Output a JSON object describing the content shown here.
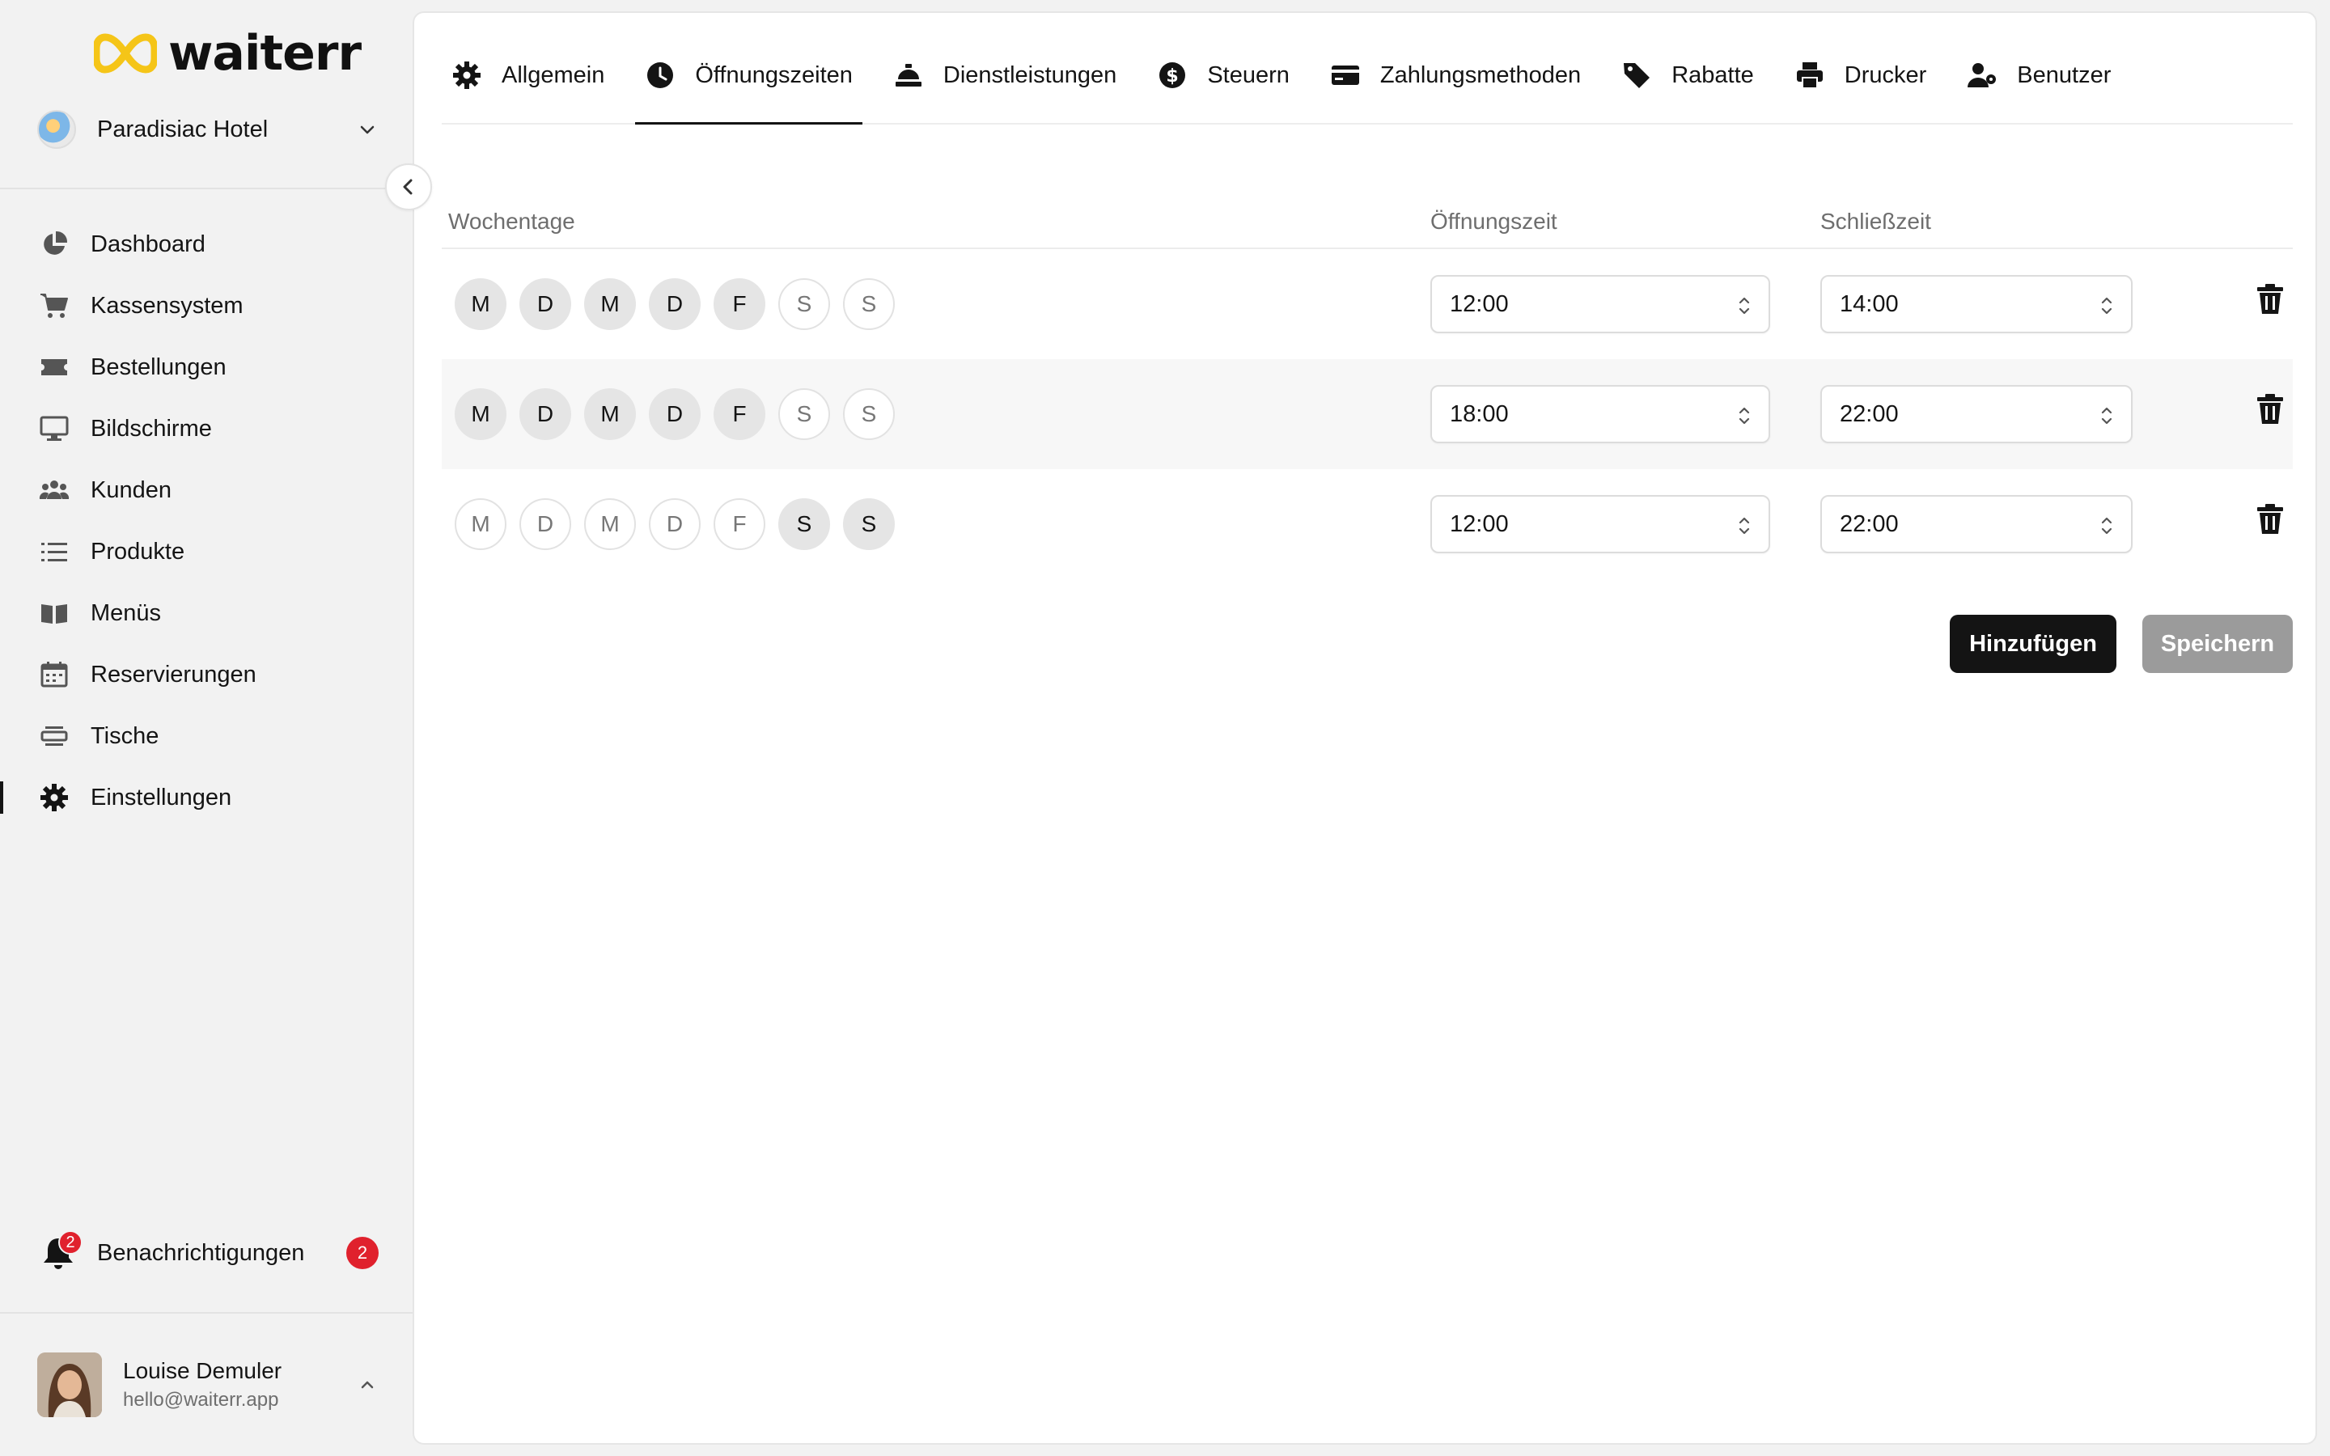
{
  "brand": {
    "logo_text": "waiterr",
    "accent": "#f5c518"
  },
  "venue": {
    "name": "Paradisiac Hotel"
  },
  "nav": {
    "items": [
      {
        "label": "Dashboard",
        "icon": "pie-chart-icon"
      },
      {
        "label": "Kassensystem",
        "icon": "cart-icon"
      },
      {
        "label": "Bestellungen",
        "icon": "ticket-icon"
      },
      {
        "label": "Bildschirme",
        "icon": "monitor-icon"
      },
      {
        "label": "Kunden",
        "icon": "users-icon"
      },
      {
        "label": "Produkte",
        "icon": "list-icon"
      },
      {
        "label": "Menüs",
        "icon": "book-icon"
      },
      {
        "label": "Reservierungen",
        "icon": "calendar-icon"
      },
      {
        "label": "Tische",
        "icon": "table-icon"
      },
      {
        "label": "Einstellungen",
        "icon": "gear-icon"
      }
    ],
    "active": "Einstellungen"
  },
  "notifications": {
    "label": "Benachrichtigungen",
    "count": "2",
    "badge_color": "#e0212d"
  },
  "user": {
    "name": "Louise Demuler",
    "email": "hello@waiterr.app"
  },
  "tabs": [
    {
      "label": "Allgemein",
      "icon": "gear-icon"
    },
    {
      "label": "Öffnungszeiten",
      "icon": "clock-icon"
    },
    {
      "label": "Dienstleistungen",
      "icon": "bell-service-icon"
    },
    {
      "label": "Steuern",
      "icon": "dollar-icon"
    },
    {
      "label": "Zahlungsmethoden",
      "icon": "credit-card-icon"
    },
    {
      "label": "Rabatte",
      "icon": "tag-icon"
    },
    {
      "label": "Drucker",
      "icon": "printer-icon"
    },
    {
      "label": "Benutzer",
      "icon": "user-gear-icon"
    }
  ],
  "active_tab": "Öffnungszeiten",
  "table": {
    "headers": {
      "weekdays": "Wochentage",
      "open": "Öffnungszeit",
      "close": "Schließzeit"
    },
    "day_letters": [
      "M",
      "D",
      "M",
      "D",
      "F",
      "S",
      "S"
    ],
    "rows": [
      {
        "days_active": [
          true,
          true,
          true,
          true,
          true,
          false,
          false
        ],
        "open": "12:00",
        "close": "14:00"
      },
      {
        "days_active": [
          true,
          true,
          true,
          true,
          true,
          false,
          false
        ],
        "open": "18:00",
        "close": "22:00"
      },
      {
        "days_active": [
          false,
          false,
          false,
          false,
          false,
          true,
          true
        ],
        "open": "12:00",
        "close": "22:00"
      }
    ]
  },
  "actions": {
    "add_label": "Hinzufügen",
    "save_label": "Speichern"
  }
}
